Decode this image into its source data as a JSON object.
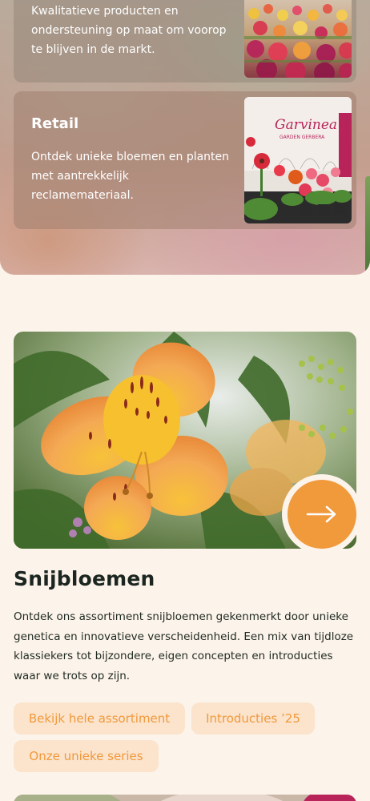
{
  "cards": [
    {
      "title": "",
      "text": "Kwalitatieve producten en ondersteuning op maat om voorop te blijven in de markt.",
      "image_icon": "flower-field-photo"
    },
    {
      "title": "Retail",
      "text": "Ontdek unieke bloemen en planten met aantrekkelijk reclamemateriaal.",
      "image_icon": "garden-center-photo",
      "sign_text": "Garvinea",
      "sign_subtext": "GARDEN GERBERA"
    }
  ],
  "product": {
    "title": "Snijbloemen",
    "description": "Ontdek ons assortiment snijbloemen gekenmerkt door unieke genetica en innovatieve verscheidenheid. Een mix van tijdloze klassiekers tot bijzondere, eigen concepten en introducties waar we trots op zijn.",
    "image_icon": "alstroemeria-photo",
    "arrow_icon": "arrow-right-icon",
    "links": [
      "Bekijk hele assortiment",
      "Introducties ’25",
      "Onze unieke series"
    ]
  },
  "colors": {
    "background": "#fcf3ea",
    "accent": "#f09a3c",
    "chip_background": "#fbe3cc",
    "heading": "#1b2620"
  }
}
